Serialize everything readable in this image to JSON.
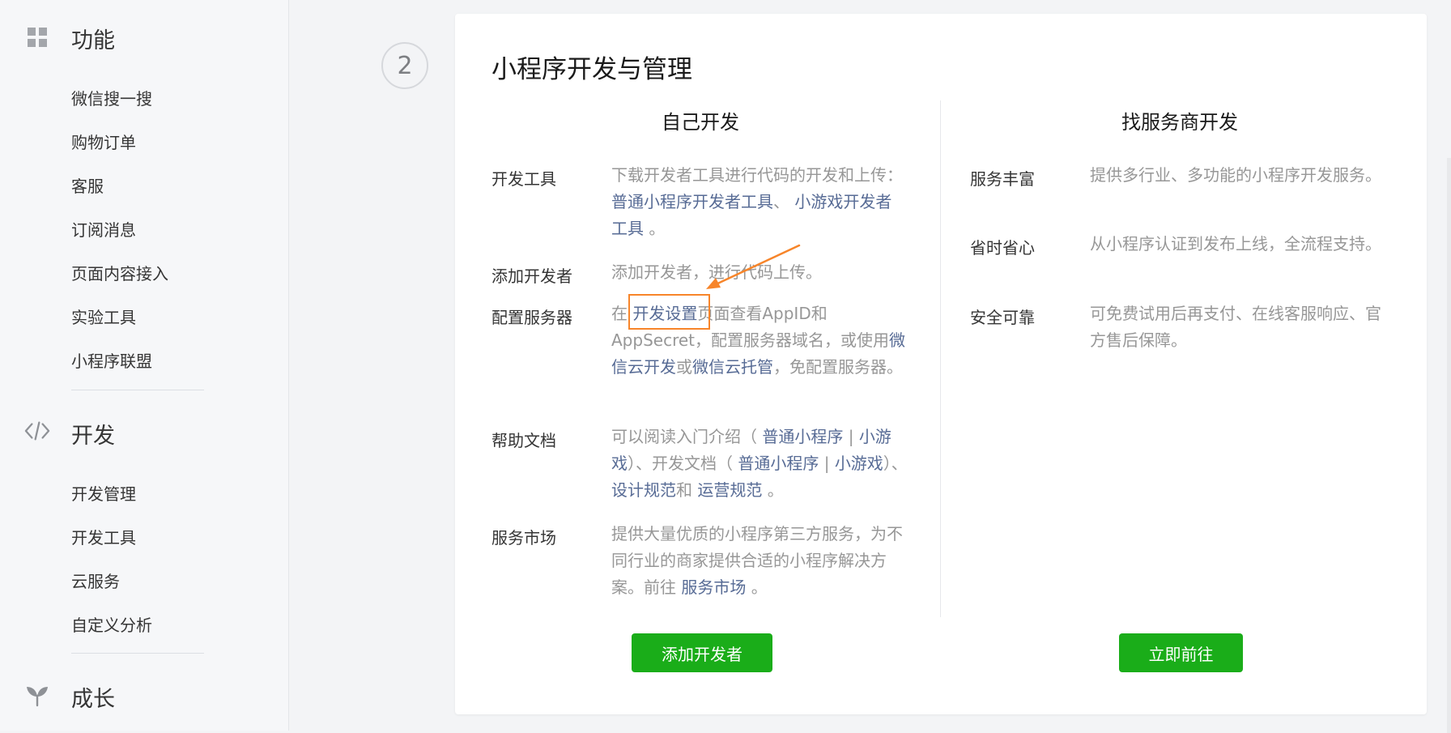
{
  "sidebar": {
    "sections": [
      {
        "title": "功能",
        "icon": "grid-icon",
        "items": [
          "微信搜一搜",
          "购物订单",
          "客服",
          "订阅消息",
          "页面内容接入",
          "实验工具",
          "小程序联盟"
        ]
      },
      {
        "title": "开发",
        "icon": "code-icon",
        "items": [
          "开发管理",
          "开发工具",
          "云服务",
          "自定义分析"
        ]
      },
      {
        "title": "成长",
        "icon": "sprout-icon",
        "items": []
      }
    ]
  },
  "step": {
    "number": "2"
  },
  "card": {
    "title": "小程序开发与管理",
    "left": {
      "title": "自己开发",
      "rows": [
        {
          "label": "开发工具",
          "t1": "下载开发者工具进行代码的开发和上传： ",
          "link1": "普通小程序开发者工具",
          "t2": "、 ",
          "link2": "小游戏开发者工具",
          "t3": " 。"
        },
        {
          "label": "添加开发者",
          "text": "添加开发者，进行代码上传。"
        },
        {
          "label": "配置服务器",
          "t1": "在 ",
          "link1": "开发设置",
          "t2": "页面查看AppID和AppSecret，配置服务器域名，或使用",
          "link2": "微信云开发",
          "t3": "或",
          "link3": "微信云托管",
          "t4": "，免配置服务器。"
        },
        {
          "label": "帮助文档",
          "t1": "可以阅读入门介绍（ ",
          "link1": "普通小程序",
          "sep1": " | ",
          "link2": "小游戏",
          "t2": "）、开发文档（ ",
          "link3": "普通小程序",
          "sep2": " | ",
          "link4": "小游戏",
          "t3": "）、 ",
          "link5": "设计规范",
          "t4": "和 ",
          "link6": "运营规范",
          "t5": " 。"
        },
        {
          "label": "服务市场",
          "t1": "提供大量优质的小程序第三方服务，为不同行业的商家提供合适的小程序解决方案。前往 ",
          "link1": "服务市场",
          "t2": " 。"
        }
      ],
      "button": "添加开发者"
    },
    "right": {
      "title": "找服务商开发",
      "rows": [
        {
          "label": "服务丰富",
          "text": "提供多行业、多功能的小程序开发服务。"
        },
        {
          "label": "省时省心",
          "text": "从小程序认证到发布上线，全流程支持。"
        },
        {
          "label": "安全可靠",
          "text": "可免费试用后再支付、在线客服响应、官方售后保障。"
        }
      ],
      "button": "立即前往"
    }
  },
  "colors": {
    "accent_green": "#1aad19",
    "link_blue": "#576b95",
    "annotation_orange": "#f7852a",
    "muted_text": "#979797"
  }
}
